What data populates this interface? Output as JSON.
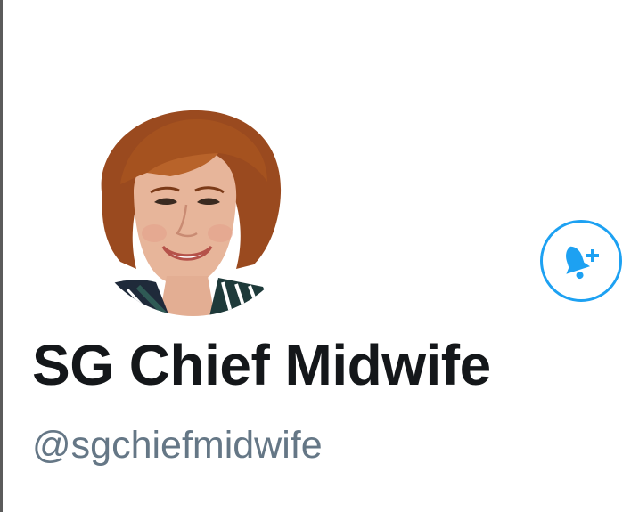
{
  "profile": {
    "display_name": "SG Chief Midwife",
    "handle": "@sgchiefmidwife",
    "avatar_icon": "profile-photo",
    "notify_icon": "bell-plus-icon"
  },
  "colors": {
    "accent": "#1da1f2",
    "name_text": "#14171a",
    "handle_text": "#657786",
    "background": "#ffffff"
  }
}
